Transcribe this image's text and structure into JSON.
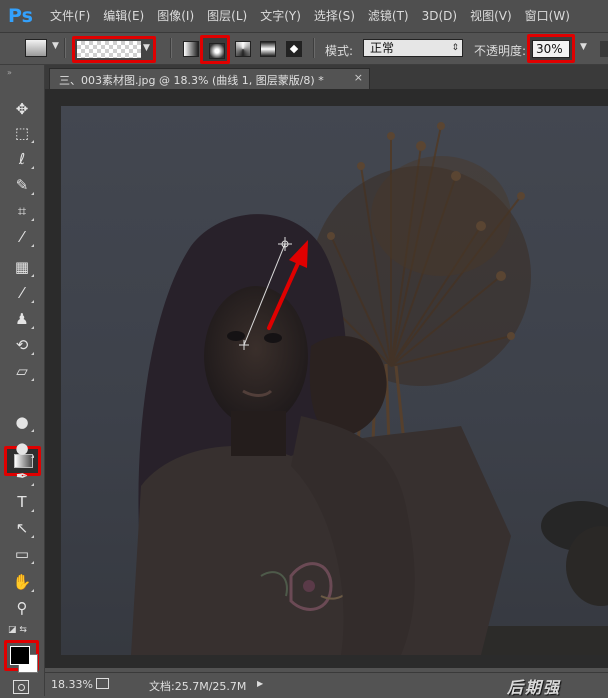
{
  "app": {
    "logo": "Ps"
  },
  "menu": [
    "文件(F)",
    "编辑(E)",
    "图像(I)",
    "图层(L)",
    "文字(Y)",
    "选择(S)",
    "滤镜(T)",
    "3D(D)",
    "视图(V)",
    "窗口(W)"
  ],
  "options": {
    "mode_label": "模式:",
    "mode_value": "正常",
    "opacity_label": "不透明度:",
    "opacity_value": "30%",
    "selected_gradient_type": "radial",
    "gradient_preset": "transparent-checker"
  },
  "document": {
    "tab_title": "三、003素材图.jpg @ 18.3% (曲线 1, 图层蒙版/8) *",
    "close_glyph": "×"
  },
  "tools": [
    "move-icon",
    "marquee-icon",
    "lasso-icon",
    "quick-select-icon",
    "crop-icon",
    "eyedropper-icon",
    "healing-icon",
    "brush-icon",
    "stamp-icon",
    "history-brush-icon",
    "eraser-icon",
    "gradient-icon",
    "blur-icon",
    "dodge-icon",
    "pen-icon",
    "type-icon",
    "path-select-icon",
    "rectangle-icon",
    "hand-icon",
    "zoom-icon"
  ],
  "tool_glyphs": {
    "move": "✥",
    "marquee": "⬚",
    "lasso": "ℓ",
    "quick_select": "✎",
    "crop": "⌗",
    "eyedropper": "⁄",
    "healing": "▦",
    "brush": "⁄",
    "stamp": "♟",
    "history": "⟲",
    "eraser": "▱",
    "blur": "●",
    "dodge": "●",
    "pen": "✒",
    "type": "T",
    "path": "↖",
    "rect": "▭",
    "hand": "✋",
    "zoom": "⚲"
  },
  "colors": {
    "foreground": "#000000",
    "background": "#ffffff",
    "highlight": "#e00000"
  },
  "status": {
    "zoom": "18.33%",
    "doc_size": "文档:25.7M/25.7M"
  },
  "watermark": "后期强"
}
